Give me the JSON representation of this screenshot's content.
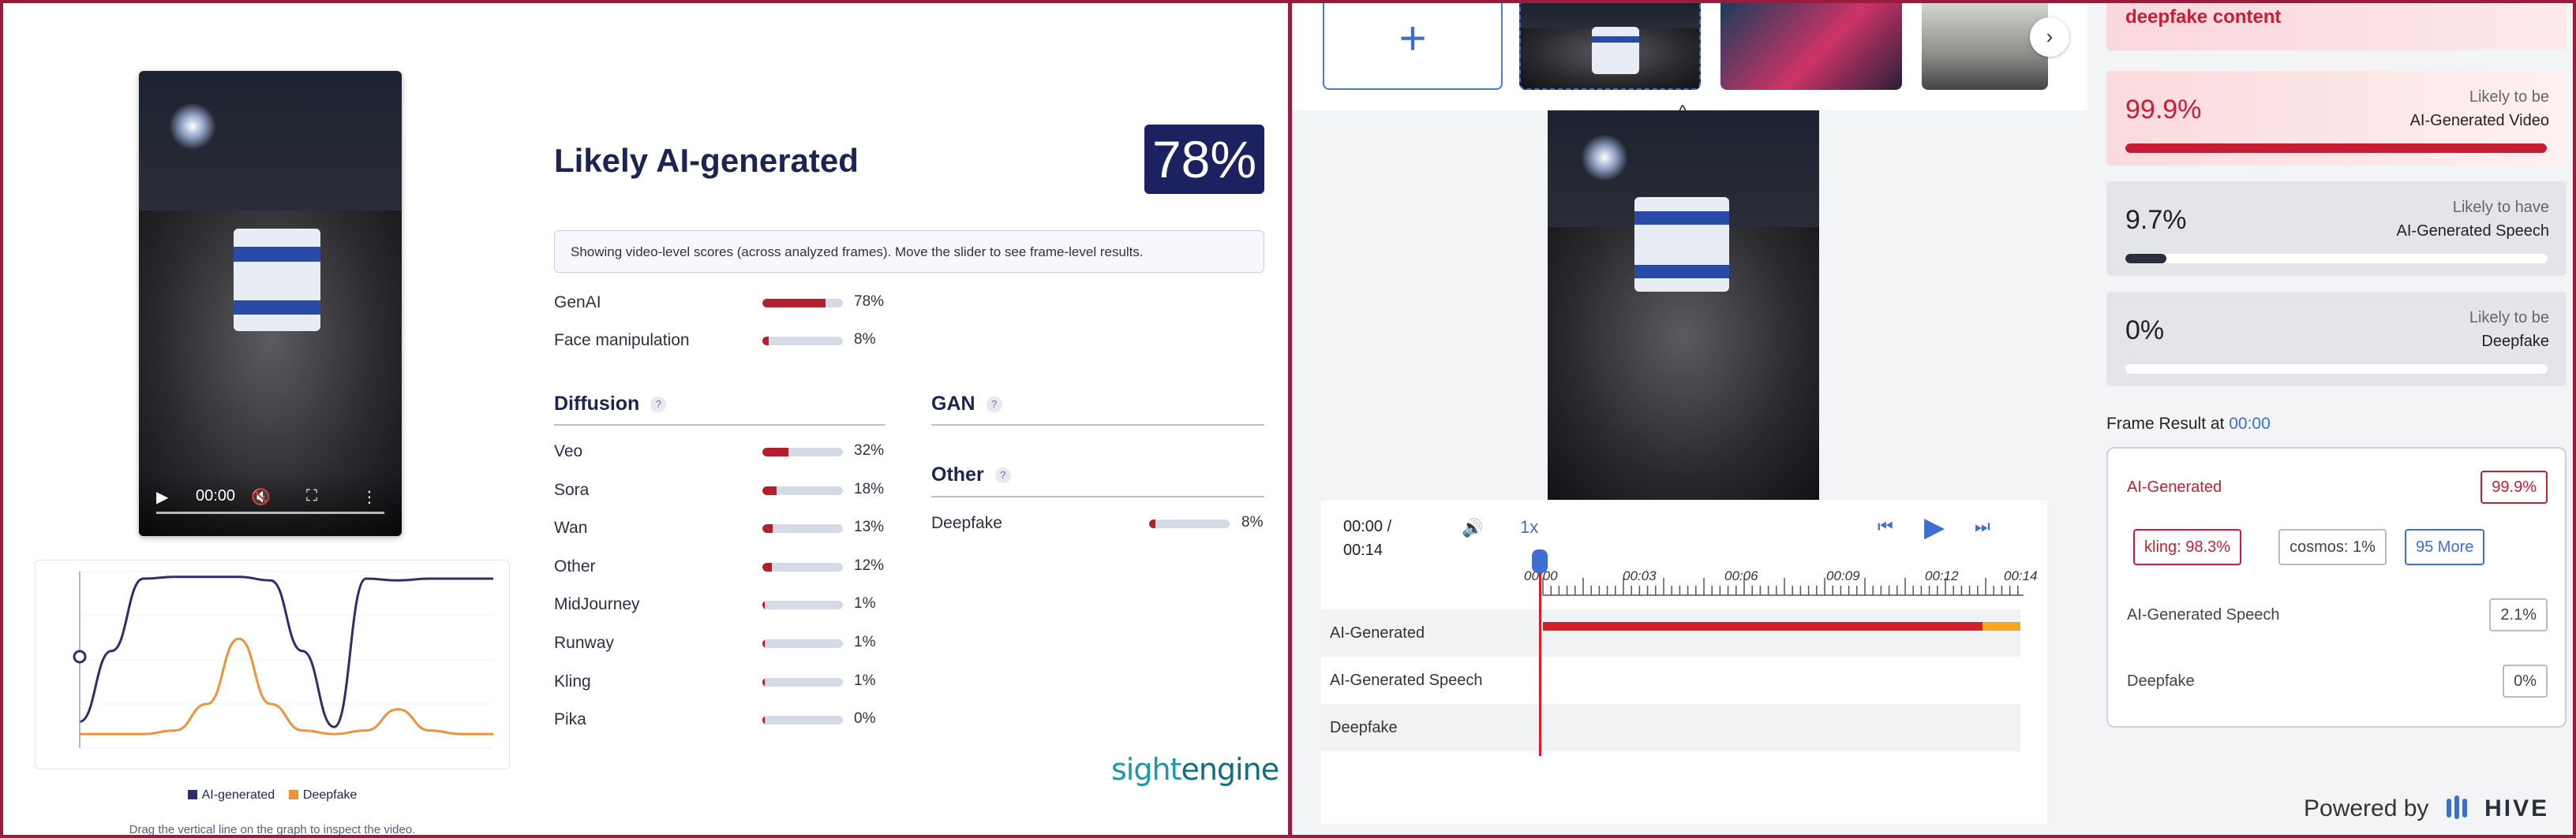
{
  "left": {
    "video": {
      "time": "00:00"
    },
    "title": "Likely AI-generated",
    "score": "78%",
    "note": "Showing video-level scores (across analyzed frames). Move the slider to see frame-level results.",
    "top_rows": [
      {
        "label": "GenAI",
        "value": 78,
        "pct": "78%"
      },
      {
        "label": "Face manipulation",
        "value": 8,
        "pct": "8%"
      }
    ],
    "diffusion": {
      "title": "Diffusion",
      "q": "?",
      "rows": [
        {
          "label": "Veo",
          "value": 32,
          "pct": "32%"
        },
        {
          "label": "Sora",
          "value": 18,
          "pct": "18%"
        },
        {
          "label": "Wan",
          "value": 13,
          "pct": "13%"
        },
        {
          "label": "Other",
          "value": 12,
          "pct": "12%"
        },
        {
          "label": "MidJourney",
          "value": 1,
          "pct": "1%"
        },
        {
          "label": "Runway",
          "value": 1,
          "pct": "1%"
        },
        {
          "label": "Kling",
          "value": 1,
          "pct": "1%"
        },
        {
          "label": "Pika",
          "value": 0,
          "pct": "0%"
        }
      ]
    },
    "gan": {
      "title": "GAN",
      "q": "?"
    },
    "other": {
      "title": "Other",
      "q": "?",
      "rows": [
        {
          "label": "Deepfake",
          "value": 8,
          "pct": "8%"
        }
      ]
    },
    "chart_legend": {
      "ai": "AI-generated",
      "deepfake": "Deepfake",
      "ai_color": "#2c2f6b",
      "deepfake_color": "#f0923a"
    },
    "hint": "Drag the vertical line on the graph to inspect the video.",
    "brand_a": "sight",
    "brand_b": "engine",
    "accent": "#b3202d"
  },
  "chart_data": {
    "type": "line",
    "title": "",
    "xlabel": "",
    "ylabel": "",
    "ylim": [
      0,
      1
    ],
    "x": [
      0,
      1,
      2,
      3,
      4,
      5,
      6,
      7,
      8,
      9,
      10,
      11,
      12,
      13
    ],
    "series": [
      {
        "name": "AI-generated",
        "values": [
          0.15,
          0.55,
          0.96,
          0.97,
          0.97,
          0.97,
          0.95,
          0.55,
          0.12,
          0.96,
          0.95,
          0.96,
          0.96,
          0.96
        ]
      },
      {
        "name": "Deepfake",
        "values": [
          0.08,
          0.08,
          0.08,
          0.1,
          0.25,
          0.62,
          0.25,
          0.1,
          0.08,
          0.1,
          0.22,
          0.1,
          0.08,
          0.08
        ]
      }
    ],
    "grid": true,
    "legend": "bottom"
  },
  "right": {
    "add_label": "+",
    "next_label": "›",
    "collapse_label": "^",
    "player": {
      "time_current": "00:00 /",
      "time_total": "00:14",
      "speed": "1x",
      "ticks": [
        "00:00",
        "00:03",
        "00:06",
        "00:09",
        "00:12",
        "00:14"
      ]
    },
    "tracks": [
      "AI-Generated",
      "AI-Generated Speech",
      "Deepfake"
    ],
    "results_header": "deepfake content",
    "results": [
      {
        "big": "99.9%",
        "l1": "Likely to be",
        "l2": "AI-Generated Video",
        "value": 99.9,
        "color": "#c81e35"
      },
      {
        "big": "9.7%",
        "l1": "Likely to have",
        "l2": "AI-Generated Speech",
        "value": 9.7,
        "color": "#2a2d3a"
      },
      {
        "big": "0%",
        "l1": "Likely to be",
        "l2": "Deepfake",
        "value": 0,
        "color": "#2a2d3a"
      }
    ],
    "frame": {
      "title": "Frame Result at",
      "time": "00:00",
      "ai_label": "AI-Generated",
      "ai_value": "99.9%",
      "chips": [
        "kling: 98.3%",
        "cosmos: 1%",
        "95 More"
      ],
      "speech_label": "AI-Generated Speech",
      "speech_value": "2.1%",
      "deepfake_label": "Deepfake",
      "deepfake_value": "0%"
    },
    "powered_by": "Powered by",
    "hive": "HIVE"
  }
}
